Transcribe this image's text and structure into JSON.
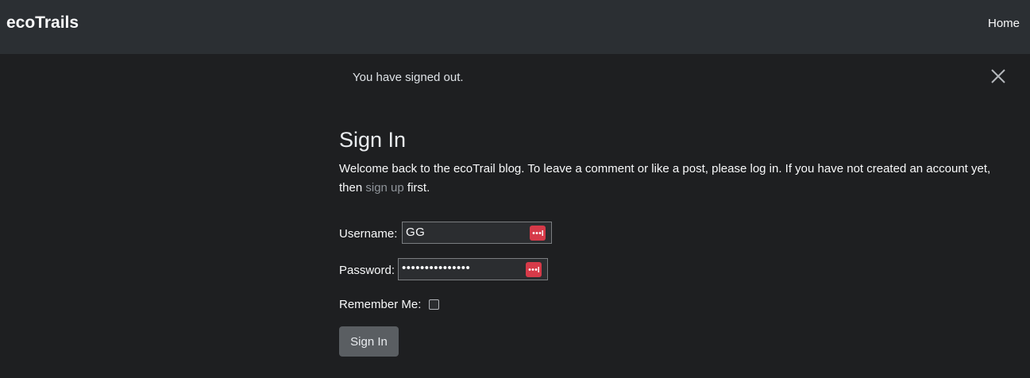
{
  "nav": {
    "brand": "ecoTrails",
    "home": "Home"
  },
  "alert": {
    "message": "You have signed out.",
    "close_icon": "close-icon"
  },
  "signin": {
    "title": "Sign In",
    "intro_before": "Welcome back to the ecoTrail blog. To leave a comment or like a post, please log in. If you have not created an account yet, then ",
    "signup_link": "sign up",
    "intro_after": " first.",
    "username_label": "Username:",
    "username_value": "GG",
    "password_label": "Password:",
    "password_value": "•••••••••••••••",
    "remember_label": "Remember Me:",
    "remember_checked": false,
    "submit_label": "Sign In",
    "password_manager_icon": "password-manager-icon"
  },
  "colors": {
    "background": "#1e1f21",
    "navbar": "#2b2f33",
    "link": "#8f949a",
    "button": "#5a5e62",
    "password_manager": "#d63a49"
  }
}
